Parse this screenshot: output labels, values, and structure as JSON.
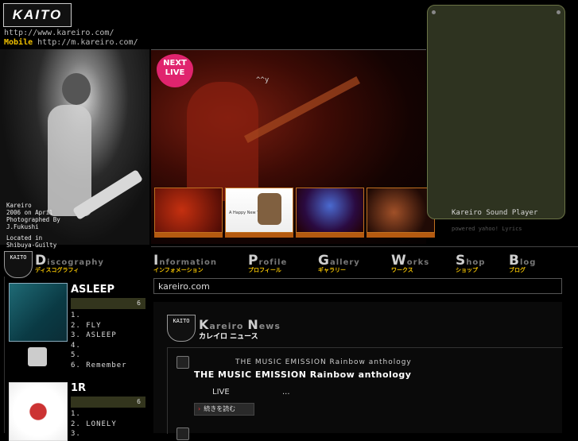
{
  "header": {
    "logo_text": "KAITO",
    "url_label": "http://www.kareiro.com/",
    "mobile_label": "Mobile",
    "mobile_url": "http://m.kareiro.com/"
  },
  "photo": {
    "caption": [
      "Kareiro",
      "2006 on April",
      "Photographed By",
      "J.Fukushi",
      "",
      "Located in",
      "Shibuya-Guilty"
    ]
  },
  "hero": {
    "next_live_1": "NEXT",
    "next_live_2": "LIVE",
    "text": "^^y",
    "thumb2_text": "A Happy New Year !"
  },
  "player": {
    "title": "Kareiro Sound Player",
    "subtitle": "powered yahoo! Lyrics"
  },
  "nav": {
    "discography_en": "discography",
    "discography_jp": "ディスコグラフィ",
    "information_en": "information",
    "information_jp": "インフォメーション",
    "profile_en": "profile",
    "profile_jp": "プロフィール",
    "gallery_en": "gallery",
    "gallery_jp": "ギャラリー",
    "works_en": "works",
    "works_jp": "ワークス",
    "shop_en": "shop",
    "shop_jp": "ショップ",
    "blog_en": "blog",
    "blog_jp": "ブログ"
  },
  "search": {
    "value": "kareiro.com"
  },
  "discography": {
    "albums": [
      {
        "title": "ASLEEP",
        "count": "6",
        "tracks": [
          "1.",
          "2. FLY",
          "3. ASLEEP",
          "4.",
          "5.",
          "6. Remember"
        ]
      },
      {
        "title": "1R",
        "count": "6",
        "tracks": [
          "1.",
          "2.    LONELY",
          "3."
        ]
      }
    ]
  },
  "news": {
    "heading_en": "Kareiro News",
    "heading_jp": "カレイロ ニュース",
    "date_line": "THE MUSIC EMISSION Rainbow anthology",
    "title": "THE MUSIC EMISSION  Rainbow anthology",
    "body_a": "LIVE",
    "body_b": "...",
    "read_more": "続きを読む"
  }
}
